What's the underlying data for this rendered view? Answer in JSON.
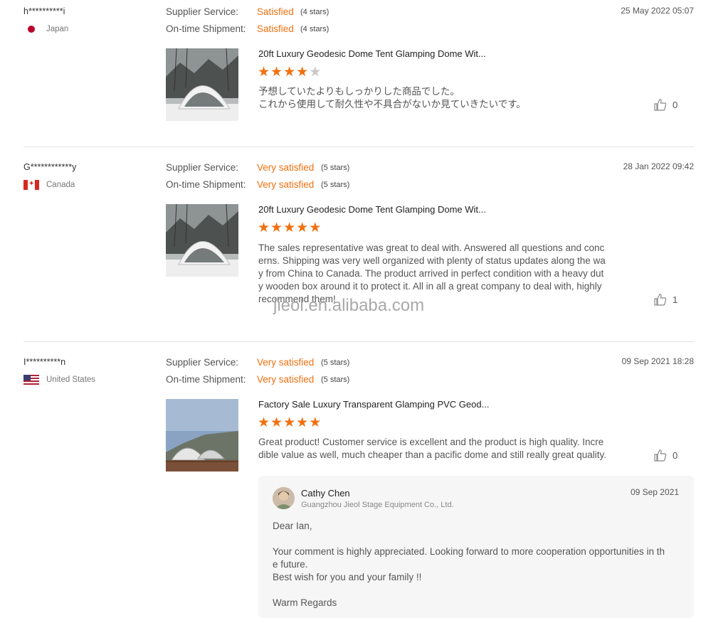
{
  "reviews": [
    {
      "username": "h**********i",
      "country": "Japan",
      "supplier_service_label": "Supplier Service:",
      "supplier_service_rating": "Satisfied",
      "supplier_service_stars": "(4 stars)",
      "shipment_label": "On-time Shipment:",
      "shipment_rating": "Satisfied",
      "shipment_stars": "(4 stars)",
      "date": "25 May 2022 05:07",
      "product_title": "20ft Luxury Geodesic Dome Tent Glamping Dome Wit...",
      "product_stars": 4,
      "comment_lines": [
        "予想していたよりもしっかりした商品でした。",
        "これから使用して耐久性や不具合がないか見ていきたいです。"
      ],
      "likes": "0"
    },
    {
      "username": "G************y",
      "country": "Canada",
      "supplier_service_label": "Supplier Service:",
      "supplier_service_rating": "Very satisfied",
      "supplier_service_stars": "(5 stars)",
      "shipment_label": "On-time Shipment:",
      "shipment_rating": "Very satisfied",
      "shipment_stars": "(5 stars)",
      "date": "28 Jan 2022 09:42",
      "product_title": "20ft Luxury Geodesic Dome Tent Glamping Dome Wit...",
      "product_stars": 5,
      "comment_lines": [
        "The sales representative was great to deal with. Answered all questions and conc",
        "erns. Shipping was very well organized with plenty of status updates along the wa",
        "y from China to Canada. The product arrived in perfect condition with a heavy dut",
        "y wooden box around it to protect it. All in all a great company to deal with, highly",
        "recommend them!"
      ],
      "likes": "1"
    },
    {
      "username": "I**********n",
      "country": "United States",
      "supplier_service_label": "Supplier Service:",
      "supplier_service_rating": "Very satisfied",
      "supplier_service_stars": "(5 stars)",
      "shipment_label": "On-time Shipment:",
      "shipment_rating": "Very satisfied",
      "shipment_stars": "(5 stars)",
      "date": "09 Sep 2021 18:28",
      "product_title": "Factory Sale Luxury Transparent Glamping PVC Geod...",
      "product_stars": 5,
      "comment_lines": [
        "Great product! Customer service is excellent and the product is high quality. Incre",
        "dible value as well, much cheaper than a pacific dome and still really great quality."
      ],
      "likes": "0"
    }
  ],
  "watermark": "jieol.en.alibaba.com",
  "reply": {
    "name": "Cathy Chen",
    "company": "Guangzhou Jieol Stage Equipment Co., Ltd.",
    "date": "09 Sep 2021",
    "greeting": "Dear Ian,",
    "body_line1": "Your comment is highly appreciated. Looking forward to more cooperation opportunities in th",
    "body_line2": "e future.",
    "body_line3": "Best wish for you and your family !!",
    "signoff": "Warm Regards"
  },
  "colors": {
    "accent": "#f2700f",
    "star_off": "#c8c8c8",
    "divider": "#e3e3e3"
  },
  "icons": {
    "like": "thumbs-up-icon"
  }
}
